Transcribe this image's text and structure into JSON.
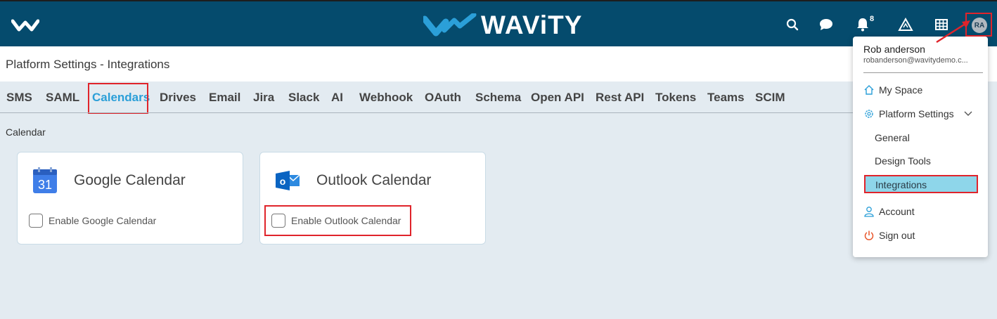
{
  "header": {
    "brand": "WAViTY",
    "notification_count": "8",
    "avatar_initials": "RA",
    "icons": [
      "home-logo-icon",
      "search-icon",
      "chat-icon",
      "bell-icon",
      "delta-icon",
      "grid-icon"
    ]
  },
  "page": {
    "title": "Platform Settings - Integrations",
    "section_label": "Calendar"
  },
  "tabs": [
    "SMS",
    "SAML",
    "Calendars",
    "Drives",
    "Email",
    "Jira",
    "Slack",
    "AI",
    "Webhook",
    "OAuth",
    "Schema",
    "Open API",
    "Rest API",
    "Tokens",
    "Teams",
    "SCIM"
  ],
  "active_tab": "Calendars",
  "cards": [
    {
      "title": "Google Calendar",
      "checkbox_label": "Enable Google Calendar",
      "checked": false,
      "icon_text": "31"
    },
    {
      "title": "Outlook Calendar",
      "checkbox_label": "Enable Outlook Calendar",
      "checked": false,
      "icon_text": "o"
    }
  ],
  "user_menu": {
    "name": "Rob anderson",
    "email": "robanderson@wavitydemo.c...",
    "items": {
      "my_space": "My Space",
      "platform_settings": "Platform Settings",
      "general": "General",
      "design_tools": "Design Tools",
      "integrations": "Integrations",
      "account": "Account",
      "sign_out": "Sign out"
    }
  },
  "colors": {
    "header_bg": "#054b6d",
    "accent": "#2b9fd8",
    "highlight_box": "#e0242b",
    "active_menu_bg": "#8ed6ea",
    "page_bg": "#e3ebf1"
  }
}
